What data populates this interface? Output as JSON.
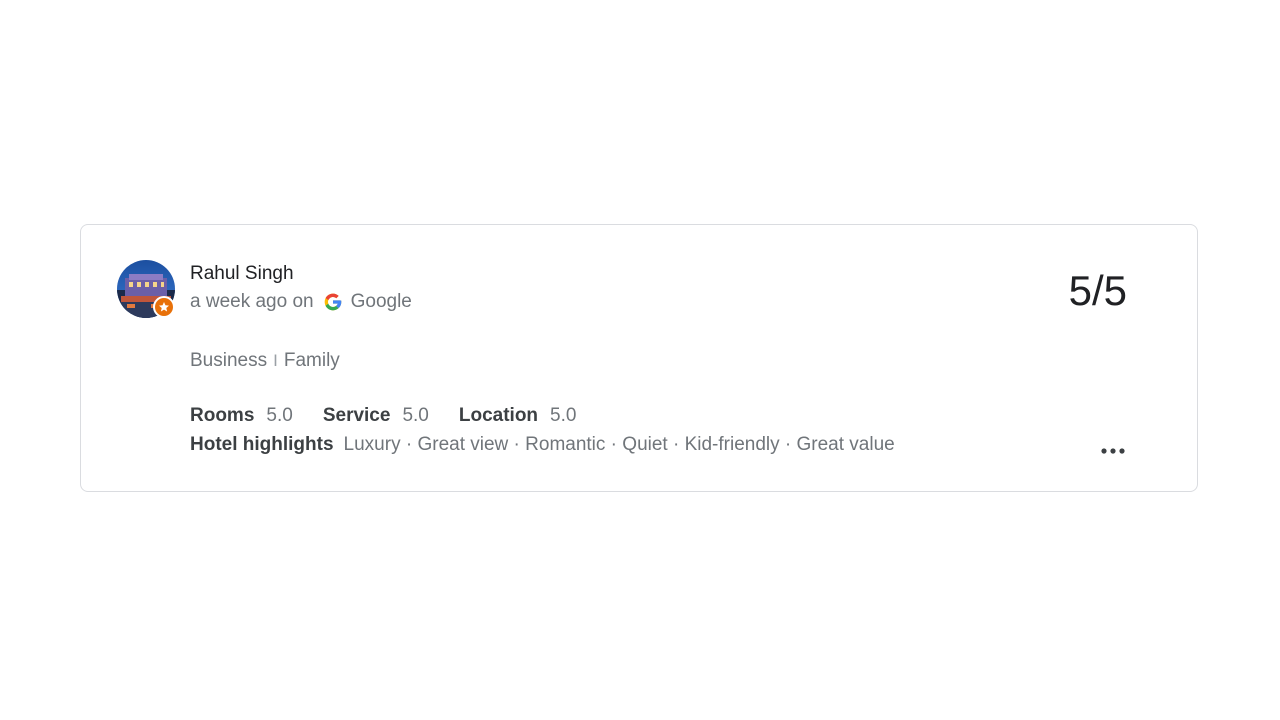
{
  "review": {
    "reviewer_name": "Rahul Singh",
    "time_ago": "a week ago on",
    "source": "Google",
    "score": "5/5",
    "trip_type": {
      "first": "Business",
      "separator": "I",
      "second": "Family"
    },
    "ratings": [
      {
        "label": "Rooms",
        "value": "5.0"
      },
      {
        "label": "Service",
        "value": "5.0"
      },
      {
        "label": "Location",
        "value": "5.0"
      }
    ],
    "highlights_label": "Hotel highlights",
    "highlights_value": "Luxury · Great view · Romantic · Quiet · Kid-friendly · Great value"
  },
  "icons": {
    "avatar": "hotel-building-avatar",
    "badge": "local-guide-star-icon",
    "source": "google-g-icon",
    "more": "more-options-icon"
  },
  "colors": {
    "badge": "#e8710a",
    "google_blue": "#4285f4",
    "google_red": "#ea4335",
    "google_yellow": "#fbbc05",
    "google_green": "#34a853"
  }
}
